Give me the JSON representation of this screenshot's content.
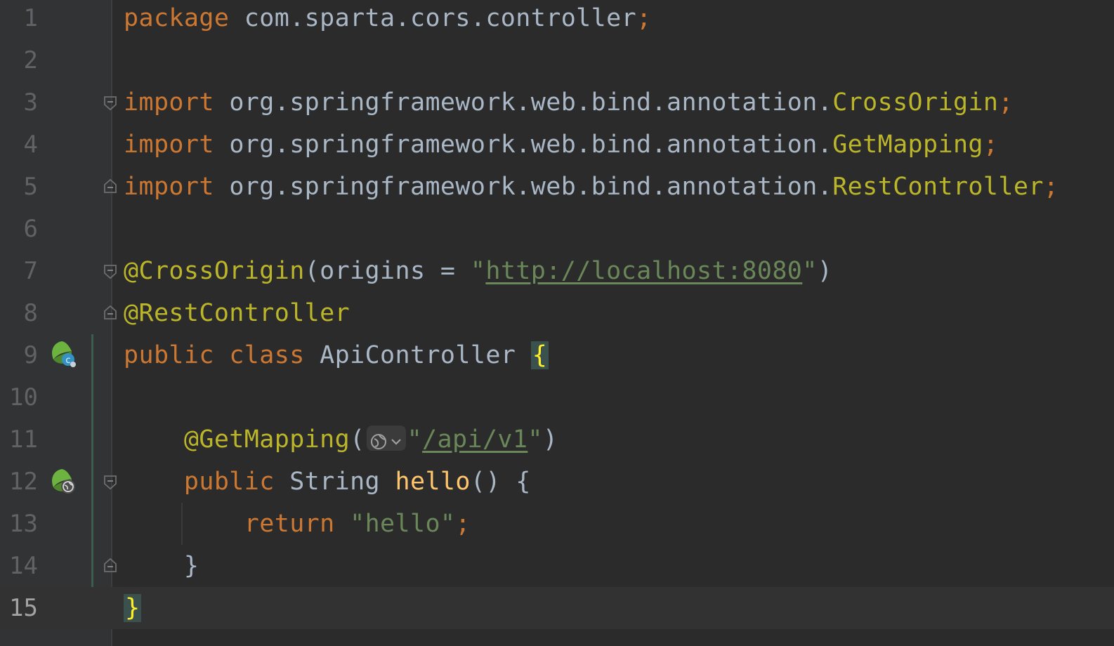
{
  "editor": {
    "language": "Java",
    "current_line": 15,
    "lines": [
      {
        "n": "1",
        "text": "package com.sparta.cors.controller;"
      },
      {
        "n": "2",
        "text": ""
      },
      {
        "n": "3",
        "text": "import org.springframework.web.bind.annotation.CrossOrigin;"
      },
      {
        "n": "4",
        "text": "import org.springframework.web.bind.annotation.GetMapping;"
      },
      {
        "n": "5",
        "text": "import org.springframework.web.bind.annotation.RestController;"
      },
      {
        "n": "6",
        "text": ""
      },
      {
        "n": "7",
        "text": "@CrossOrigin(origins = \"http://localhost:8080\")"
      },
      {
        "n": "8",
        "text": "@RestController"
      },
      {
        "n": "9",
        "text": "public class ApiController {"
      },
      {
        "n": "10",
        "text": ""
      },
      {
        "n": "11",
        "text": "    @GetMapping(\"/api/v1\")"
      },
      {
        "n": "12",
        "text": "    public String hello() {"
      },
      {
        "n": "13",
        "text": "        return \"hello\";"
      },
      {
        "n": "14",
        "text": "    }"
      },
      {
        "n": "15",
        "text": "}"
      }
    ],
    "tokens": {
      "l1": [
        "package",
        " com.sparta.cors.controller",
        ";"
      ],
      "l3": [
        "import",
        " org.springframework.web.bind.annotation.",
        "CrossOrigin",
        ";"
      ],
      "l4": [
        "import",
        " org.springframework.web.bind.annotation.",
        "GetMapping",
        ";"
      ],
      "l5": [
        "import",
        " org.springframework.web.bind.annotation.",
        "RestController",
        ";"
      ],
      "l7": [
        "@CrossOrigin",
        "(origins = ",
        "\"",
        "http://localhost:8080",
        "\"",
        ")"
      ],
      "l8": [
        "@RestController"
      ],
      "l9": [
        "public",
        " ",
        "class",
        " ApiController ",
        "{"
      ],
      "l11": [
        "    @GetMapping",
        "(",
        "\"",
        "/api/v1",
        "\"",
        ")"
      ],
      "l12": [
        "    public",
        " String ",
        "hello",
        "() {"
      ],
      "l13": [
        "        return",
        " ",
        "\"hello\"",
        ";"
      ],
      "l14": [
        "    }"
      ],
      "l15": [
        "}"
      ]
    },
    "gutter_icons": [
      {
        "line": "9",
        "icon": "spring-bean-icon"
      },
      {
        "line": "12",
        "icon": "spring-endpoint-icon"
      }
    ],
    "fold_markers": [
      "3",
      "5",
      "7",
      "8",
      "12",
      "14"
    ],
    "colors": {
      "background": "#2b2b2b",
      "gutter": "#313335",
      "keyword": "#cc7832",
      "annotation": "#bbb529",
      "string": "#6a8759",
      "text": "#a9b7c6",
      "method": "#ffc66d",
      "line_number": "#606366",
      "current_line": "#323232",
      "spring_green": "#6db33f"
    }
  }
}
